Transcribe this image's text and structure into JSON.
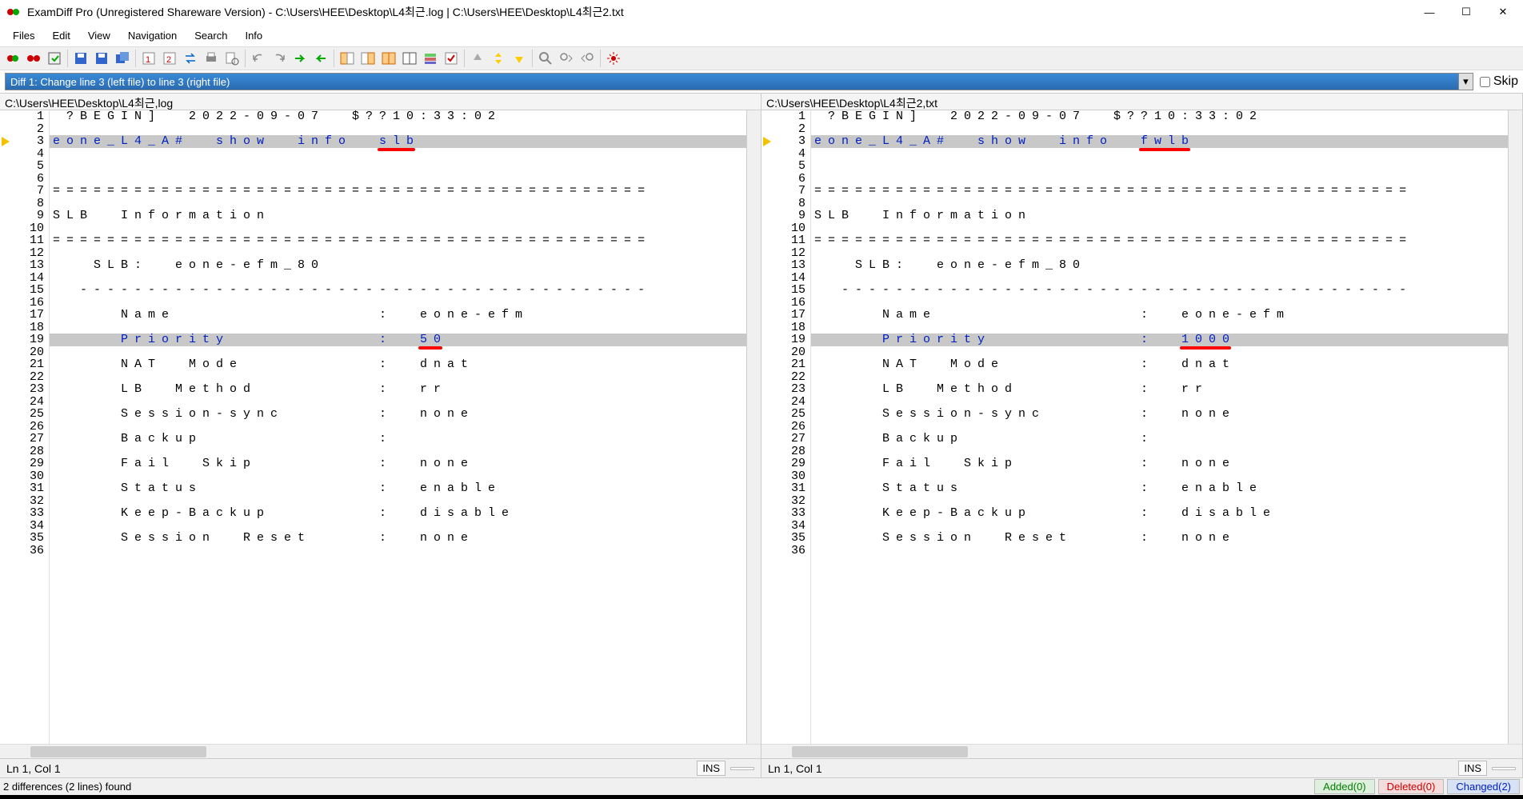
{
  "title": "ExamDiff Pro (Unregistered Shareware Version) - C:\\Users\\HEE\\Desktop\\L4최근.log  |  C:\\Users\\HEE\\Desktop\\L4최근2.txt",
  "menus": [
    "Files",
    "Edit",
    "View",
    "Navigation",
    "Search",
    "Info"
  ],
  "diff_selector": "Diff 1: Change line 3 (left file) to line 3 (right file)",
  "skip_label": "Skip",
  "left_file": "C:\\Users\\HEE\\Desktop\\L4최근,log",
  "right_file": "C:\\Users\\HEE\\Desktop\\L4최근2,txt",
  "left_lines": [
    {
      "n": 1,
      "t": " ?BEGIN]  2022-09-07  $??10:33:02"
    },
    {
      "n": 2,
      "t": ""
    },
    {
      "n": 3,
      "t": "eone_L4_A#  show  info  ",
      "d": "slb",
      "chg": true
    },
    {
      "n": 4,
      "t": ""
    },
    {
      "n": 5,
      "t": ""
    },
    {
      "n": 6,
      "t": ""
    },
    {
      "n": 7,
      "t": "============================================"
    },
    {
      "n": 8,
      "t": ""
    },
    {
      "n": 9,
      "t": "SLB  Information"
    },
    {
      "n": 10,
      "t": ""
    },
    {
      "n": 11,
      "t": "============================================"
    },
    {
      "n": 12,
      "t": ""
    },
    {
      "n": 13,
      "t": "   SLB:  eone-efm_80"
    },
    {
      "n": 14,
      "t": ""
    },
    {
      "n": 15,
      "t": "  ------------------------------------------"
    },
    {
      "n": 16,
      "t": ""
    },
    {
      "n": 17,
      "t": "     Name               :  eone-efm"
    },
    {
      "n": 18,
      "t": ""
    },
    {
      "n": 19,
      "t": "     Priority           :  ",
      "d": "50",
      "chg": true
    },
    {
      "n": 20,
      "t": ""
    },
    {
      "n": 21,
      "t": "     NAT  Mode          :  dnat"
    },
    {
      "n": 22,
      "t": ""
    },
    {
      "n": 23,
      "t": "     LB  Method         :  rr"
    },
    {
      "n": 24,
      "t": ""
    },
    {
      "n": 25,
      "t": "     Session-sync       :  none"
    },
    {
      "n": 26,
      "t": ""
    },
    {
      "n": 27,
      "t": "     Backup             :"
    },
    {
      "n": 28,
      "t": ""
    },
    {
      "n": 29,
      "t": "     Fail  Skip         :  none"
    },
    {
      "n": 30,
      "t": ""
    },
    {
      "n": 31,
      "t": "     Status             :  enable"
    },
    {
      "n": 32,
      "t": ""
    },
    {
      "n": 33,
      "t": "     Keep-Backup        :  disable"
    },
    {
      "n": 34,
      "t": ""
    },
    {
      "n": 35,
      "t": "     Session  Reset     :  none"
    },
    {
      "n": 36,
      "t": ""
    }
  ],
  "right_lines": [
    {
      "n": 1,
      "t": " ?BEGIN]  2022-09-07  $??10:33:02"
    },
    {
      "n": 2,
      "t": ""
    },
    {
      "n": 3,
      "t": "eone_L4_A#  show  info  ",
      "d": "fwlb",
      "chg": true
    },
    {
      "n": 4,
      "t": ""
    },
    {
      "n": 5,
      "t": ""
    },
    {
      "n": 6,
      "t": ""
    },
    {
      "n": 7,
      "t": "============================================"
    },
    {
      "n": 8,
      "t": ""
    },
    {
      "n": 9,
      "t": "SLB  Information"
    },
    {
      "n": 10,
      "t": ""
    },
    {
      "n": 11,
      "t": "============================================"
    },
    {
      "n": 12,
      "t": ""
    },
    {
      "n": 13,
      "t": "   SLB:  eone-efm_80"
    },
    {
      "n": 14,
      "t": ""
    },
    {
      "n": 15,
      "t": "  ------------------------------------------"
    },
    {
      "n": 16,
      "t": ""
    },
    {
      "n": 17,
      "t": "     Name               :  eone-efm"
    },
    {
      "n": 18,
      "t": ""
    },
    {
      "n": 19,
      "t": "     Priority           :  ",
      "d": "1000",
      "chg": true
    },
    {
      "n": 20,
      "t": ""
    },
    {
      "n": 21,
      "t": "     NAT  Mode          :  dnat"
    },
    {
      "n": 22,
      "t": ""
    },
    {
      "n": 23,
      "t": "     LB  Method         :  rr"
    },
    {
      "n": 24,
      "t": ""
    },
    {
      "n": 25,
      "t": "     Session-sync       :  none"
    },
    {
      "n": 26,
      "t": ""
    },
    {
      "n": 27,
      "t": "     Backup             :"
    },
    {
      "n": 28,
      "t": ""
    },
    {
      "n": 29,
      "t": "     Fail  Skip         :  none"
    },
    {
      "n": 30,
      "t": ""
    },
    {
      "n": 31,
      "t": "     Status             :  enable"
    },
    {
      "n": 32,
      "t": ""
    },
    {
      "n": 33,
      "t": "     Keep-Backup        :  disable"
    },
    {
      "n": 34,
      "t": ""
    },
    {
      "n": 35,
      "t": "     Session  Reset     :  none"
    },
    {
      "n": 36,
      "t": ""
    }
  ],
  "status_left": "Ln 1, Col 1",
  "status_ins": "INS",
  "status_right": "Ln 1, Col 1",
  "summary": "2 differences (2 lines) found",
  "added": "Added(0)",
  "deleted": "Deleted(0)",
  "changed": "Changed(2)",
  "toolbar_icons": [
    "compare-files-icon",
    "compare-dirs-icon",
    "recompare-icon",
    "sep",
    "save-left-icon",
    "save-right-icon",
    "save-both-icon",
    "sep",
    "view-first-icon",
    "view-second-icon",
    "swap-icon",
    "print-icon",
    "print-preview-icon",
    "sep",
    "undo-icon",
    "redo-icon",
    "next-diff-icon",
    "prev-diff-icon",
    "sep",
    "diff-pane1-icon",
    "diff-pane2-icon",
    "diff-both-icon",
    "toggle-split-icon",
    "color-legend-icon",
    "options-check-icon",
    "sep",
    "up-arrow-icon",
    "updown-icon",
    "down-arrow-icon",
    "sep",
    "find-icon",
    "find-next-icon",
    "find-prev-icon",
    "sep",
    "tools-icon"
  ]
}
